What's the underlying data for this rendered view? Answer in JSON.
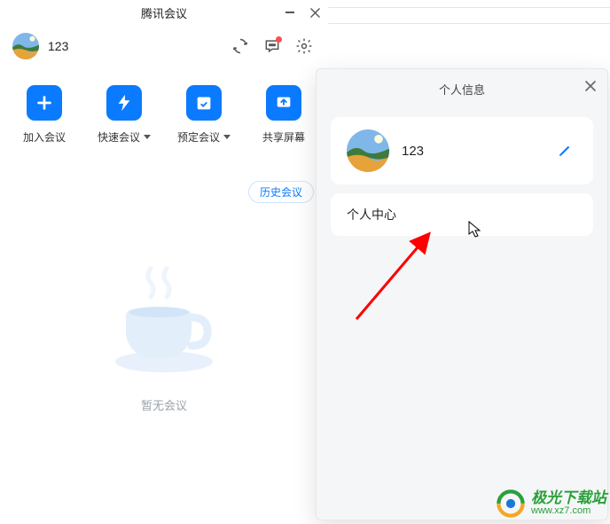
{
  "window": {
    "title": "腾讯会议"
  },
  "user": {
    "name": "123"
  },
  "actions": {
    "join": "加入会议",
    "quick": "快速会议",
    "schedule": "预定会议",
    "share": "共享屏幕"
  },
  "history_label": "历史会议",
  "empty_text": "暂无会议",
  "popover": {
    "title": "个人信息",
    "profile_name": "123",
    "menu_personal_center": "个人中心"
  },
  "watermark": {
    "line1": "极光下载站",
    "line2": "www.xz7.com"
  },
  "colors": {
    "primary": "#0a7bff",
    "arrow": "#ff0000"
  }
}
